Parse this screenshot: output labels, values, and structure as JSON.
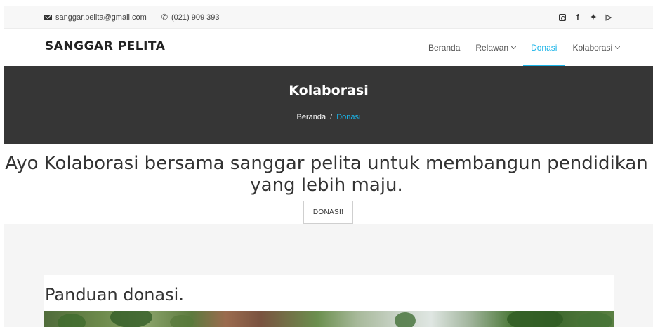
{
  "topbar": {
    "email": "sanggar.pelita@gmail.com",
    "phone": "(021) 909 393",
    "social_icons": [
      "instagram-icon",
      "facebook-icon",
      "twitter-icon",
      "youtube-icon"
    ]
  },
  "nav": {
    "brand": "SANGGAR PELITA",
    "items": [
      {
        "label": "Beranda",
        "dropdown": false,
        "active": false
      },
      {
        "label": "Relawan",
        "dropdown": true,
        "active": false
      },
      {
        "label": "Donasi",
        "dropdown": false,
        "active": true
      },
      {
        "label": "Kolaborasi",
        "dropdown": true,
        "active": false
      }
    ]
  },
  "hero": {
    "title": "Kolaborasi",
    "breadcrumb": [
      "Beranda",
      "/",
      "Donasi"
    ]
  },
  "intro": {
    "line1": "Ayo Kolaborasi bersama sanggar pelita untuk membangun pendidikan",
    "line2": "yang lebih maju.",
    "button": "DONASI!"
  },
  "section": {
    "heading": "Panduan donasi."
  },
  "colors": {
    "accent": "#1ab4e8",
    "hero_bg": "#363636",
    "section_bg": "#f5f5f5"
  }
}
